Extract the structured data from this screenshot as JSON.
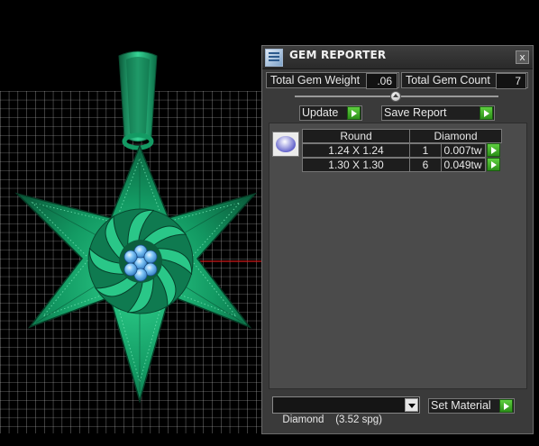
{
  "window": {
    "title": "GEM REPORTER",
    "close_glyph": "x"
  },
  "stats": {
    "total_gem_weight_label": "Total Gem Weight",
    "total_gem_weight_value": ".06",
    "total_gem_count_label": "Total Gem Count",
    "total_gem_count_value": "7"
  },
  "actions": {
    "update_label": "Update",
    "save_report_label": "Save Report"
  },
  "gem_table": {
    "header_shape": "Round",
    "header_material": "Diamond",
    "rows": [
      {
        "size": "1.24 X 1.24",
        "count": "1",
        "weight": "0.007tw"
      },
      {
        "size": "1.30 X 1.30",
        "count": "6",
        "weight": "0.049tw"
      }
    ]
  },
  "material": {
    "selected": "Diamond    (3.52 spg)",
    "set_label": "Set Material"
  },
  "colors": {
    "pendant_green": "#17a06a",
    "gem_blue": "#4fa8e8",
    "axis_red": "#d01818",
    "play_green": "#3cb024"
  },
  "icons": {
    "app": "gem-reporter-app-icon",
    "gem": "round-gem-icon",
    "play": "green-play-arrow-icon"
  }
}
